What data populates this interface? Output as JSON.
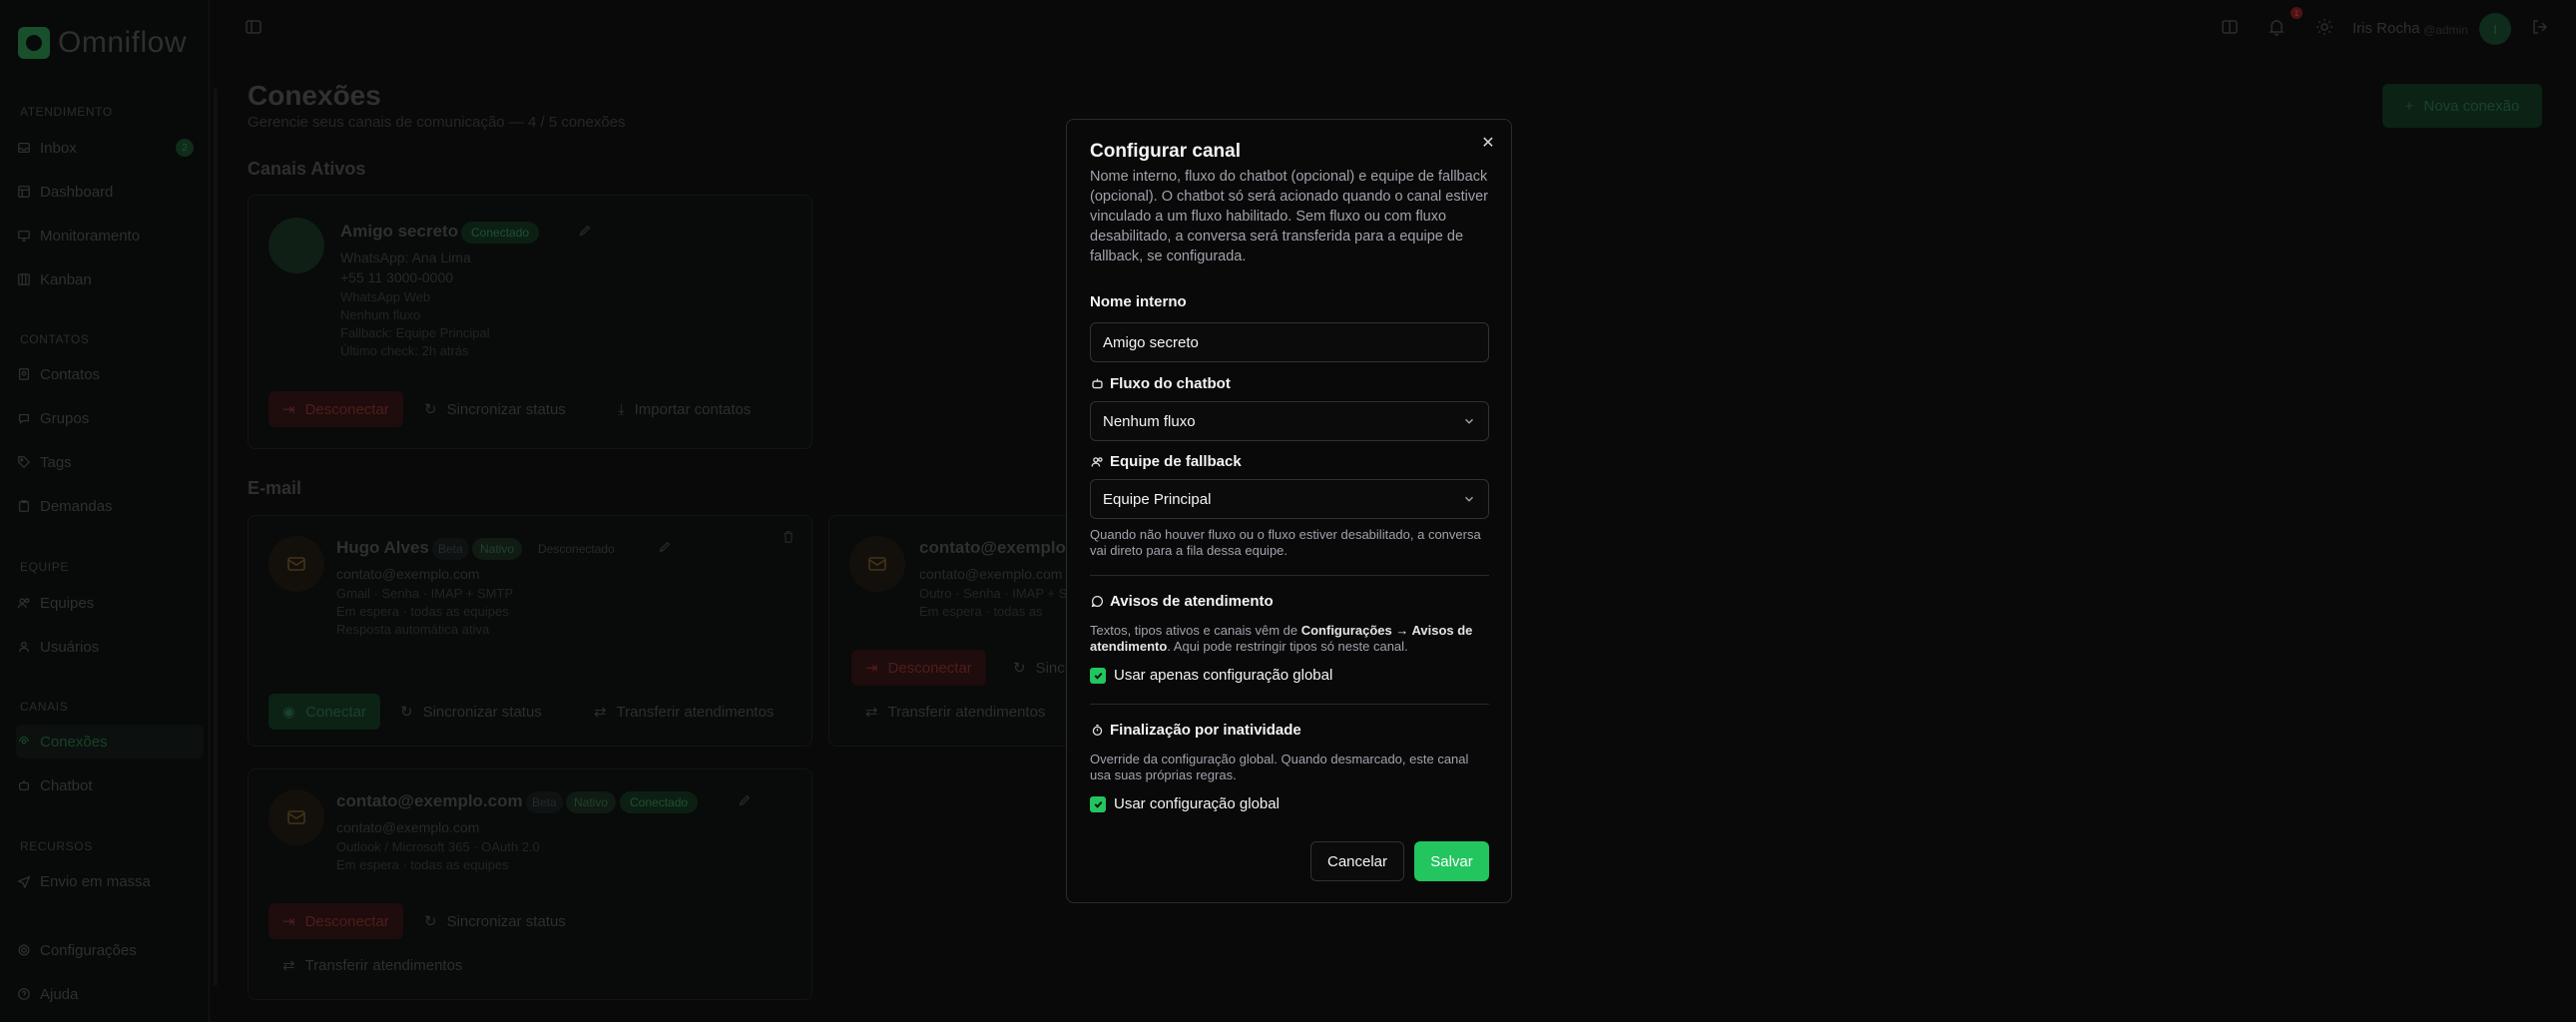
{
  "app": {
    "name": "Omniflow"
  },
  "topbar": {
    "user_name": "Iris Rocha",
    "user_handle": "@admin",
    "avatar_initial": "I",
    "notifications": "1"
  },
  "sidebar": {
    "sections": [
      "ATENDIMENTO",
      "CONTATOS",
      "EQUIPE",
      "CANAIS",
      "RECURSOS"
    ],
    "items": [
      {
        "label": "Inbox",
        "badge": "2"
      },
      {
        "label": "Dashboard"
      },
      {
        "label": "Monitoramento"
      },
      {
        "label": "Kanban"
      },
      {
        "label": "Contatos"
      },
      {
        "label": "Grupos"
      },
      {
        "label": "Tags"
      },
      {
        "label": "Demandas"
      },
      {
        "label": "Equipes"
      },
      {
        "label": "Usuários"
      },
      {
        "label": "Conexões"
      },
      {
        "label": "Chatbot"
      },
      {
        "label": "Envio em massa"
      },
      {
        "label": "Configurações"
      },
      {
        "label": "Ajuda"
      }
    ]
  },
  "page": {
    "title": "Conexões",
    "subtitle": "Gerencie seus canais de comunicação — 4 / 5 conexões",
    "new_button": "Nova conexão",
    "section_active": "Canais Ativos",
    "section_email": "E-mail"
  },
  "cards": {
    "whatsapp": {
      "name": "Amigo secreto",
      "status": "Conectado",
      "lines": [
        "WhatsApp: Ana Lima",
        "+55 11 3000-0000",
        "WhatsApp Web",
        "Nenhum fluxo",
        "Fallback: Equipe Principal",
        "Último check: 2h atrás"
      ],
      "actions": [
        "Desconectar",
        "Sincronizar status",
        "Importar contatos"
      ]
    },
    "email1": {
      "name": "Hugo Alves",
      "beta": "Beta",
      "native": "Nativo",
      "status": "Desconectado",
      "lines": [
        "contato@exemplo.com",
        "Gmail · Senha · IMAP + SMTP",
        "Em espera · todas as equipes",
        "Resposta automática ativa"
      ],
      "actions": [
        "Conectar",
        "Sincronizar status",
        "Transferir atendimentos"
      ]
    },
    "email2": {
      "name": "contato@exemplo",
      "lines": [
        "contato@exemplo.com",
        "Outro · Senha · IMAP + SM",
        "Em espera · todas as"
      ],
      "actions": [
        "Desconectar",
        "Sincr",
        "Transferir atendimentos"
      ]
    },
    "email3": {
      "name": "contato@exemplo.com",
      "beta": "Beta",
      "native": "Nativo",
      "status": "Conectado",
      "lines": [
        "contato@exemplo.com",
        "Outlook / Microsoft 365 · OAuth 2.0",
        "Em espera · todas as equipes"
      ],
      "actions": [
        "Desconectar",
        "Sincronizar status",
        "Transferir atendimentos"
      ]
    }
  },
  "modal": {
    "title": "Configurar canal",
    "description": "Nome interno, fluxo do chatbot (opcional) e equipe de fallback (opcional). O chatbot só será acionado quando o canal estiver vinculado a um fluxo habilitado. Sem fluxo ou com fluxo desabilitado, a conversa será transferida para a equipe de fallback, se configurada.",
    "name_label": "Nome interno",
    "name_value": "Amigo secreto",
    "flow_label": "Fluxo do chatbot",
    "flow_value": "Nenhum fluxo",
    "fallback_label": "Equipe de fallback",
    "fallback_value": "Equipe Principal",
    "fallback_help": "Quando não houver fluxo ou o fluxo estiver desabilitado, a conversa vai direto para a fila dessa equipe.",
    "notices_label": "Avisos de atendimento",
    "notices_help_pre": "Textos, tipos ativos e canais vêm de ",
    "notices_help_bold": "Configurações → Avisos de atendimento",
    "notices_help_post": ". Aqui pode restringir tipos só neste canal.",
    "notices_check": "Usar apenas configuração global",
    "inactivity_label": "Finalização por inatividade",
    "inactivity_help": "Override da configuração global. Quando desmarcado, este canal usa suas próprias regras.",
    "inactivity_check": "Usar configuração global",
    "cancel": "Cancelar",
    "save": "Salvar"
  },
  "colors": {
    "accent": "#22c55e",
    "danger": "#6b2626",
    "modal_bg": "#09090a"
  }
}
